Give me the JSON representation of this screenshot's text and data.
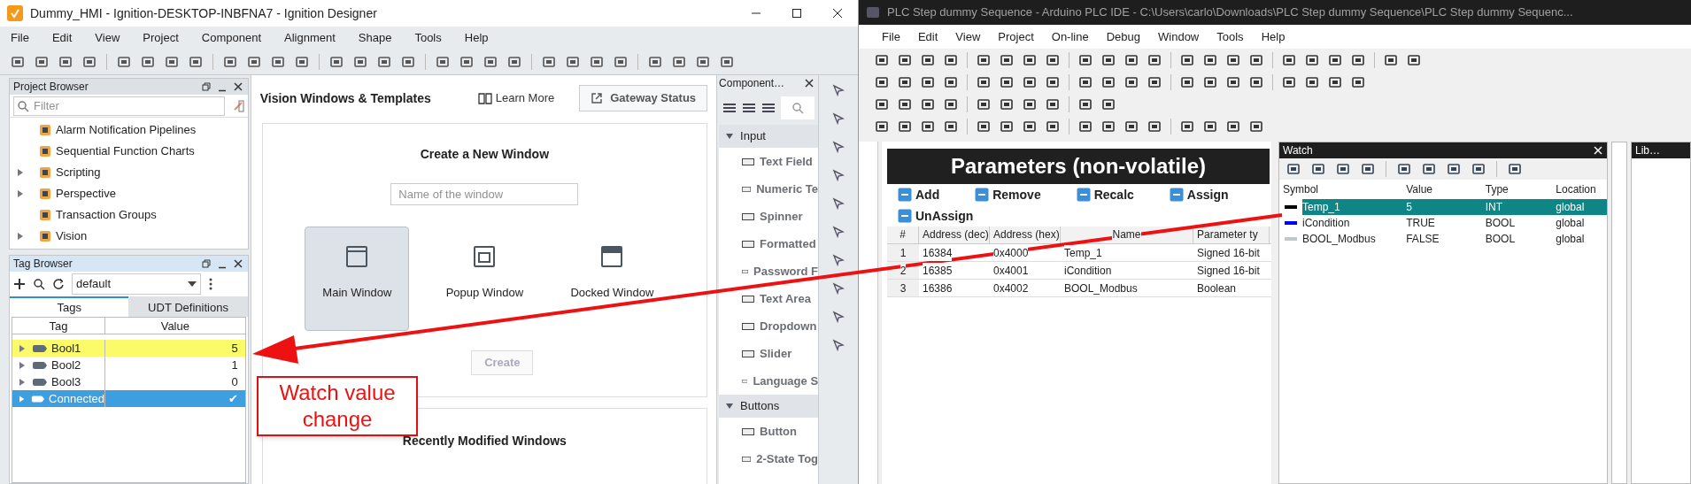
{
  "designer": {
    "title": "Dummy_HMI - Ignition-DESKTOP-INBFNA7 - Ignition Designer",
    "menu": [
      "File",
      "Edit",
      "View",
      "Project",
      "Component",
      "Alignment",
      "Shape",
      "Tools",
      "Help"
    ],
    "project_browser": {
      "title": "Project Browser",
      "filter": {
        "placeholder": "Filter"
      },
      "items": [
        {
          "label": "Alarm Notification Pipelines",
          "expandable": false
        },
        {
          "label": "Sequential Function Charts",
          "expandable": false
        },
        {
          "label": "Scripting",
          "expandable": true
        },
        {
          "label": "Perspective",
          "expandable": true
        },
        {
          "label": "Transaction Groups",
          "expandable": false
        },
        {
          "label": "Vision",
          "expandable": true
        }
      ]
    },
    "tag_browser": {
      "title": "Tag Browser",
      "provider": "default",
      "tabs": [
        {
          "label": "Tags",
          "selected": true
        },
        {
          "label": "UDT Definitions",
          "selected": false
        }
      ],
      "columns": [
        "Tag",
        "Value"
      ],
      "rows": [
        {
          "tag": "Bool1",
          "value": "5",
          "highlighted": true,
          "selected": false
        },
        {
          "tag": "Bool2",
          "value": "1",
          "highlighted": false,
          "selected": false
        },
        {
          "tag": "Bool3",
          "value": "0",
          "highlighted": false,
          "selected": false
        },
        {
          "tag": "Connected",
          "value": "✔",
          "highlighted": false,
          "selected": true
        }
      ]
    },
    "workspace": {
      "heading": "Vision Windows & Templates",
      "learn_more": "Learn More",
      "gateway_status": "Gateway Status",
      "create": {
        "title": "Create a New Window",
        "name_field": {
          "placeholder": "Name of the window"
        },
        "options": [
          {
            "label": "Main Window",
            "kind": "main",
            "selected": true
          },
          {
            "label": "Popup Window",
            "kind": "popup",
            "selected": false
          },
          {
            "label": "Docked Window",
            "kind": "docked",
            "selected": false
          }
        ],
        "button": {
          "label": "Create",
          "disabled": true
        }
      },
      "recent_title": "Recently Modified Windows"
    },
    "component_palette": {
      "title": "Component…",
      "groups": [
        {
          "label": "Input",
          "items": [
            "Text Field",
            "Numeric Te",
            "Spinner",
            "Formatted",
            "Password F",
            "Text Area",
            "Dropdown",
            "Slider",
            "Language S"
          ]
        },
        {
          "label": "Buttons",
          "items": [
            "Button",
            "2-State Tog"
          ]
        }
      ]
    }
  },
  "plc_ide": {
    "title": "PLC Step dummy Sequence - Arduino PLC IDE - C:\\Users\\carlo\\Downloads\\PLC Step dummy Sequence\\PLC Step dummy Sequenc...",
    "menu": [
      "File",
      "Edit",
      "View",
      "Project",
      "On-line",
      "Debug",
      "Window",
      "Tools",
      "Help"
    ],
    "parameters": {
      "title": "Parameters (non-volatile)",
      "actions": [
        "Add",
        "Remove",
        "Recalc",
        "Assign",
        "UnAssign"
      ],
      "columns": [
        "#",
        "Address (dec)",
        "Address (hex)",
        "Name",
        "Parameter ty"
      ],
      "rows": [
        [
          "1",
          "16384",
          "0x4000",
          "Temp_1",
          "Signed 16-bit"
        ],
        [
          "2",
          "16385",
          "0x4001",
          "iCondition",
          "Signed 16-bit"
        ],
        [
          "3",
          "16386",
          "0x4002",
          "BOOL_Modbus",
          "Boolean"
        ]
      ]
    },
    "watch": {
      "title": "Watch",
      "columns": [
        "Symbol",
        "Value",
        "Type",
        "Location"
      ],
      "rows": [
        {
          "symbol": "Temp_1",
          "value": "5",
          "type": "INT",
          "location": "global",
          "color": "#000000",
          "selected": true
        },
        {
          "symbol": "iCondition",
          "value": "TRUE",
          "type": "BOOL",
          "location": "global",
          "color": "#0000ff",
          "selected": false
        },
        {
          "symbol": "BOOL_Modbus",
          "value": "FALSE",
          "type": "BOOL",
          "location": "global",
          "color": "#c0c8cc",
          "selected": false
        }
      ]
    },
    "library": {
      "title": "Lib…"
    }
  },
  "annotation": {
    "text": "Watch value change"
  }
}
